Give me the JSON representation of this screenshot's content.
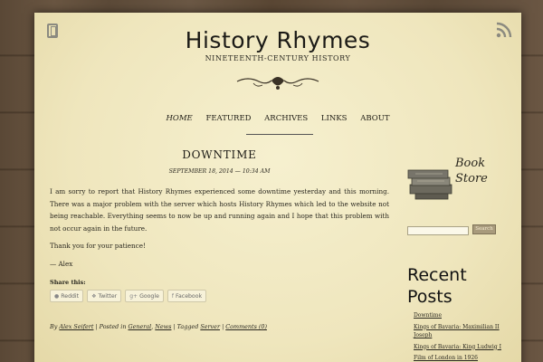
{
  "site": {
    "title": "History Rhymes",
    "description": "NINETEENTH-CENTURY HISTORY"
  },
  "nav": {
    "items": [
      "HOME",
      "FEATURED",
      "ARCHIVES",
      "LINKS",
      "ABOUT"
    ],
    "active": "HOME"
  },
  "post": {
    "title": "DOWNTIME",
    "date": "SEPTEMBER 18, 2014 — 10:34 AM",
    "paragraph_1": "I am sorry to report that History Rhymes experienced some downtime yesterday and this morning. There was a major problem with the server which hosts History Rhymes which led to the website not being reachable. Everything seems to now be up and running again and I hope that this problem with not occur again in the future.",
    "paragraph_2": "Thank you for your patience!",
    "signature": "— Alex",
    "share_label": "Share this:",
    "share_buttons": [
      "Reddit",
      "Twitter",
      "Google",
      "Facebook"
    ],
    "meta": {
      "by": "By",
      "author": "Alex Seifert",
      "posted_in": "| Posted in",
      "category_1": "General",
      "comma": ",",
      "category_2": "News",
      "tagged": "| Tagged",
      "tag": "Server",
      "separator": "|",
      "comments": "Comments (0)"
    }
  },
  "sidebar": {
    "book_store_line1": "Book",
    "book_store_line2": "Store",
    "search_button": "Search",
    "recent_title_line1": "Recent",
    "recent_title_line2": "Posts",
    "recent_posts": [
      "Downtime",
      "Kings of Bavaria: Maximilian II Joseph",
      "Kings of Bavaria: King Ludwig I",
      "Film of London in 1926"
    ]
  },
  "colors": {
    "paper": "#f2eac6",
    "wood": "#5f4c3a",
    "text": "#2a281f"
  }
}
